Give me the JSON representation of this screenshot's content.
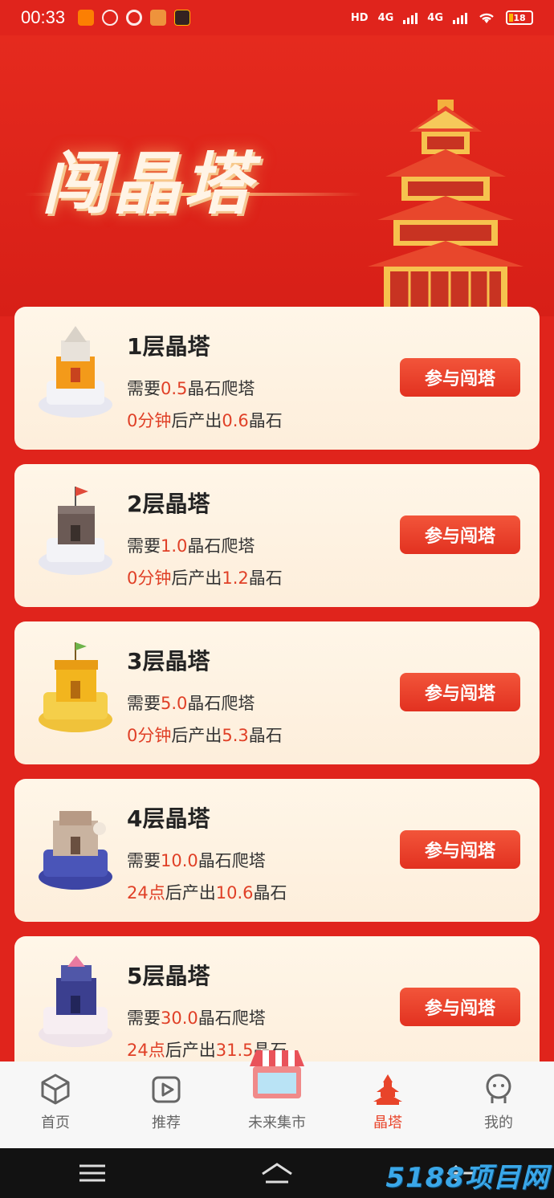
{
  "status_bar": {
    "time": "00:33",
    "network_labels": [
      "HD",
      "4G",
      "4G"
    ],
    "battery": "18"
  },
  "hero": {
    "title": "闯晶塔"
  },
  "towers": [
    {
      "title": "1层晶塔",
      "need_prefix": "需要",
      "need_value": "0.5",
      "need_suffix": "晶石爬塔",
      "time_value": "0分钟",
      "output_mid": "后产出",
      "output_value": "0.6",
      "output_suffix": "晶石",
      "button": "参与闯塔",
      "thumb_color": "#f39a1a"
    },
    {
      "title": "2层晶塔",
      "need_prefix": "需要",
      "need_value": "1.0",
      "need_suffix": "晶石爬塔",
      "time_value": "0分钟",
      "output_mid": "后产出",
      "output_value": "1.2",
      "output_suffix": "晶石",
      "button": "参与闯塔",
      "thumb_color": "#6b5a55"
    },
    {
      "title": "3层晶塔",
      "need_prefix": "需要",
      "need_value": "5.0",
      "need_suffix": "晶石爬塔",
      "time_value": "0分钟",
      "output_mid": "后产出",
      "output_value": "5.3",
      "output_suffix": "晶石",
      "button": "参与闯塔",
      "thumb_color": "#f2b51e"
    },
    {
      "title": "4层晶塔",
      "need_prefix": "需要",
      "need_value": "10.0",
      "need_suffix": "晶石爬塔",
      "time_value": "24点",
      "output_mid": "后产出",
      "output_value": "10.6",
      "output_suffix": "晶石",
      "button": "参与闯塔",
      "thumb_color": "#4a55b8"
    },
    {
      "title": "5层晶塔",
      "need_prefix": "需要",
      "need_value": "30.0",
      "need_suffix": "晶石爬塔",
      "time_value": "24点",
      "output_mid": "后产出",
      "output_value": "31.5",
      "output_suffix": "晶石",
      "button": "参与闯塔",
      "thumb_color": "#3b3f8f"
    }
  ],
  "tabbar": {
    "items": [
      {
        "label": "首页",
        "icon": "cube-icon"
      },
      {
        "label": "推荐",
        "icon": "play-icon"
      },
      {
        "label": "未来集市",
        "icon": "store-icon"
      },
      {
        "label": "晶塔",
        "icon": "tower-icon",
        "active": true
      },
      {
        "label": "我的",
        "icon": "profile-icon"
      }
    ]
  },
  "watermark": "5188项目网",
  "colors": {
    "background": "#e0241c",
    "accent": "#e8442a",
    "button": "#e23120",
    "card": "#fff6e8"
  }
}
